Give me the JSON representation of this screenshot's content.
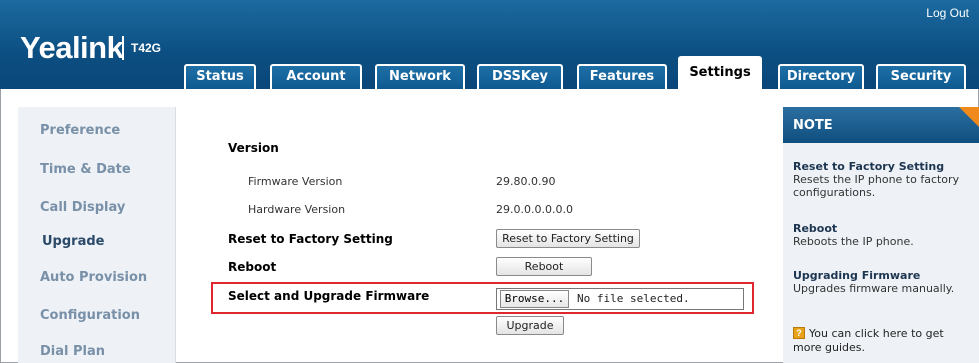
{
  "brand": {
    "logo": "Yealink",
    "model": "T42G"
  },
  "header": {
    "logout": "Log Out"
  },
  "tabs": [
    {
      "label": "Status"
    },
    {
      "label": "Account"
    },
    {
      "label": "Network"
    },
    {
      "label": "DSSKey"
    },
    {
      "label": "Features"
    },
    {
      "label": "Settings",
      "active": true
    },
    {
      "label": "Directory"
    },
    {
      "label": "Security"
    }
  ],
  "sidebar": {
    "items": [
      {
        "label": "Preference"
      },
      {
        "label": "Time & Date"
      },
      {
        "label": "Call Display"
      },
      {
        "label": "Upgrade",
        "active": true
      },
      {
        "label": "Auto Provision"
      },
      {
        "label": "Configuration"
      },
      {
        "label": "Dial Plan"
      }
    ]
  },
  "main": {
    "version_heading": "Version",
    "firmware_label": "Firmware Version",
    "firmware_value": "29.80.0.90",
    "hardware_label": "Hardware Version",
    "hardware_value": "29.0.0.0.0.0.0",
    "reset_label": "Reset to Factory Setting",
    "reset_button": "Reset to Factory Setting",
    "reboot_label": "Reboot",
    "reboot_button": "Reboot",
    "upgrade_label": "Select and Upgrade Firmware",
    "browse_button": "Browse...",
    "file_status": "No file selected.",
    "upgrade_button": "Upgrade"
  },
  "note": {
    "title": "NOTE",
    "items": [
      {
        "title": "Reset to Factory Setting",
        "desc": "Resets the IP phone to factory configurations."
      },
      {
        "title": "Reboot",
        "desc": "Reboots the IP phone."
      },
      {
        "title": "Upgrading Firmware",
        "desc": "Upgrades firmware manually."
      }
    ],
    "guide_text": "You can click here to get more guides.",
    "guide_icon": "?"
  },
  "colors": {
    "header": "#0c4f82",
    "highlight": "#e0262e",
    "note_corner": "#f08a1c"
  }
}
